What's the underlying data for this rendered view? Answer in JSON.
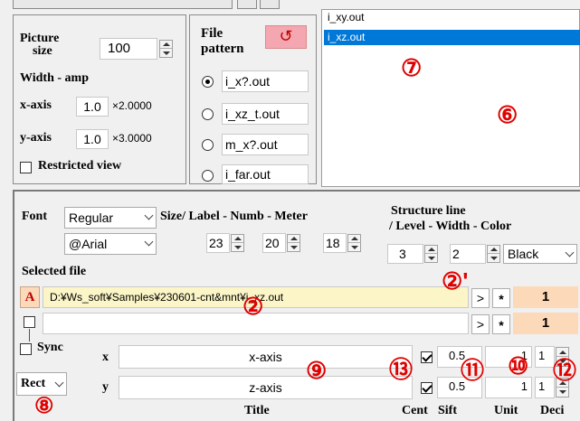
{
  "colors": {
    "accent_red": "#e00000",
    "selected_blue": "#0078d7",
    "file_highlight": "#fbf5c7",
    "peach": "#fcd9b8",
    "reset_button": "#f4a7b0"
  },
  "picture": {
    "label_line1": "Picture",
    "label_line2": "size",
    "size_value": "100",
    "width_amp_label": "Width - amp",
    "x_axis_label": "x-axis",
    "x_value": "1.0",
    "x_mult": "×2.0000",
    "y_axis_label": "y-axis",
    "y_value": "1.0",
    "y_mult": "×3.0000",
    "restricted_label": "Restricted view"
  },
  "file_pattern": {
    "label_line1": "File",
    "label_line2": "pattern",
    "reset_icon": "↺",
    "options": [
      "i_x?.out",
      "i_xz_t.out",
      "m_x?.out",
      "i_far.out"
    ],
    "selected_index": 0
  },
  "file_list": {
    "items": [
      "i_xy.out",
      "i_xz.out"
    ],
    "selected_index": 1
  },
  "font_row": {
    "font_label": "Font",
    "style_value": "Regular",
    "face_value": "@Arial",
    "size_label": "Size/ Label - Numb - Meter",
    "label_size": "23",
    "numb_size": "20",
    "meter_size": "18"
  },
  "structure": {
    "title_line1": "Structure line",
    "title_line2": "/ Level - Width - Color",
    "level": "3",
    "width": "2",
    "color": "Black"
  },
  "selected": {
    "label": "Selected file",
    "row1_tag": "A",
    "row1_path": "D:¥Ws_soft¥Samples¥230601-cnt&mnt¥i_xz.out",
    "row1_value": "1",
    "row2_path": "",
    "row2_value": "1",
    "arrow_btn": ">",
    "star_btn": "*"
  },
  "axes": {
    "sync_label": "Sync",
    "coord_value": "Rect",
    "x_letter": "x",
    "y_letter": "y",
    "x_title": "x-axis",
    "y_title": "z-axis",
    "x_sift": "0.5",
    "y_sift": "0.5",
    "x_unit": "1",
    "y_unit": "1",
    "x_deci": "1",
    "y_deci": "1",
    "footer_title": "Title",
    "footer_cent": "Cent",
    "footer_sift": "Sift",
    "footer_unit": "Unit",
    "footer_deci": "Deci"
  },
  "annotations": {
    "n2": "②",
    "n2p": "②'",
    "n6": "⑥",
    "n7": "⑦",
    "n8": "⑧",
    "n9": "⑨",
    "n10": "⑩",
    "n11": "⑪",
    "n12": "⑫",
    "n13": "⑬"
  }
}
